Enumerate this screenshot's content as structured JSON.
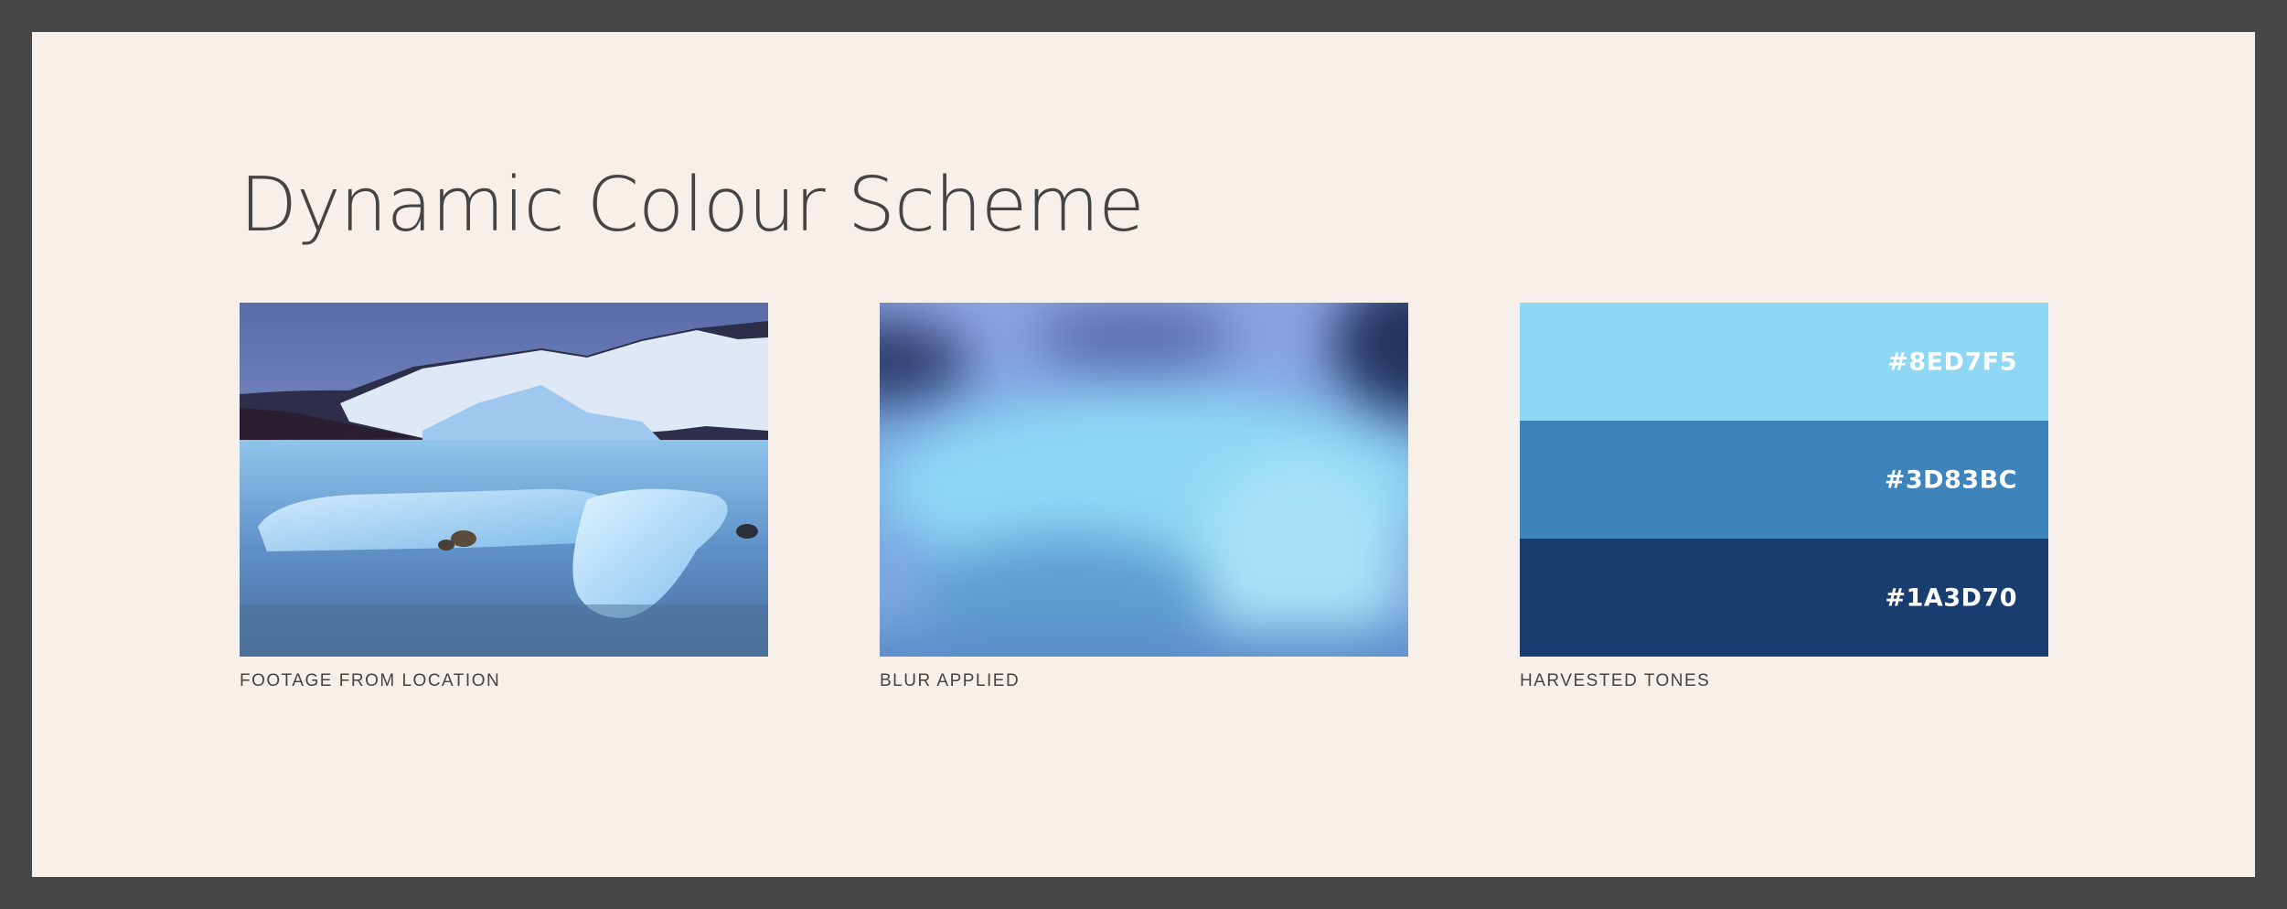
{
  "title": "Dynamic Colour Scheme",
  "captions": {
    "footage": "FOOTAGE FROM LOCATION",
    "blur": "BLUR APPLIED",
    "tones": "HARVESTED TONES"
  },
  "swatches": [
    {
      "hex": "#8ED7F5",
      "color": "#8ED7F5"
    },
    {
      "hex": "#3D83BC",
      "color": "#3D83BC"
    },
    {
      "hex": "#1A3D70",
      "color": "#1A3D70"
    }
  ],
  "colors": {
    "background": "#F6EFEA",
    "border": "#484848",
    "text": "#444444"
  }
}
